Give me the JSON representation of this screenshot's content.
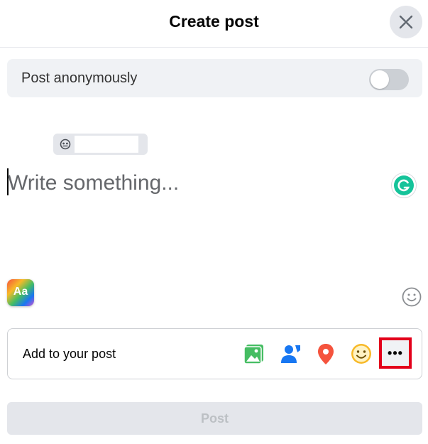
{
  "header": {
    "title": "Create post",
    "close_icon": "close-icon"
  },
  "anonymous": {
    "label": "Post anonymously",
    "enabled": false
  },
  "audience": {
    "icon": "mask-icon",
    "name": ""
  },
  "composer": {
    "placeholder": "Write something..."
  },
  "grammarly": {
    "icon": "grammarly-icon"
  },
  "background_button": {
    "label": "Aa"
  },
  "emoji_icon": "smiley-icon",
  "add_to_post": {
    "label": "Add to your post",
    "icons": [
      "photo-video-icon",
      "tag-people-icon",
      "location-icon",
      "feeling-icon",
      "more-icon"
    ],
    "more_label": "•••"
  },
  "post_button": {
    "label": "Post",
    "enabled": false
  },
  "colors": {
    "facebook_blue": "#1877f2",
    "photo_green": "#45bd62",
    "location_red": "#f5533d",
    "feeling_yellow": "#f7b928",
    "highlight": "#e3001b"
  }
}
